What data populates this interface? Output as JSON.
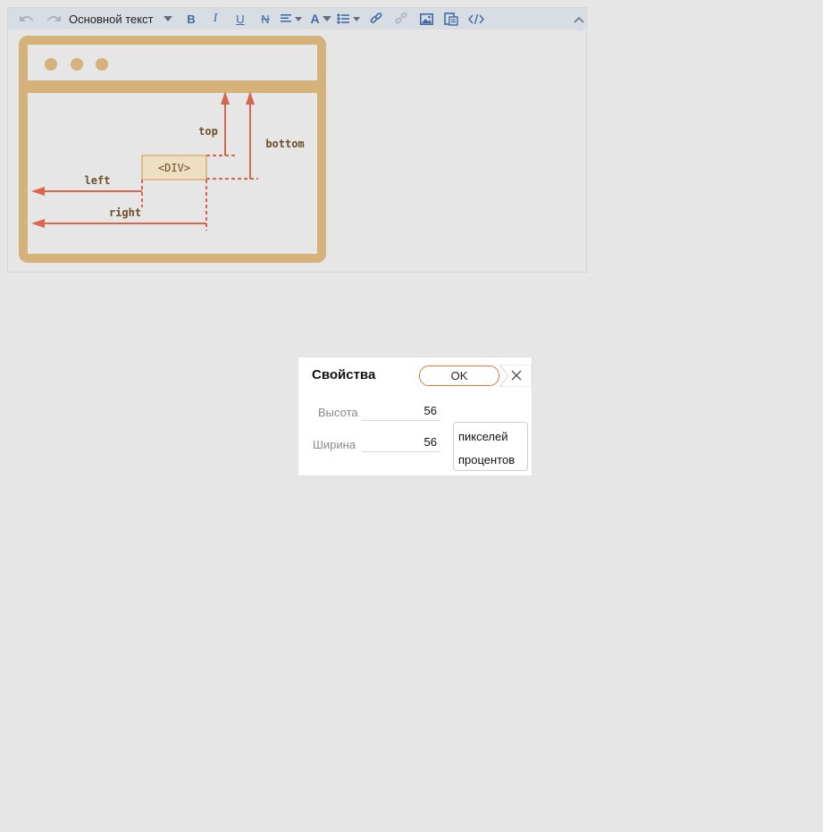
{
  "toolbar": {
    "format_label": "Основной текст",
    "icons": [
      "undo-icon",
      "redo-icon",
      "bold-icon",
      "italic-icon",
      "underline-icon",
      "strikethrough-icon",
      "align-icon",
      "font-color-icon",
      "list-icon",
      "link-icon",
      "unlink-icon",
      "image-icon",
      "paste-icon",
      "source-code-icon",
      "collapse-icon"
    ],
    "bold_glyph": "B",
    "italic_glyph": "I",
    "underline_glyph": "U",
    "strike_glyph": "N",
    "fontcolor_glyph": "A"
  },
  "figure": {
    "div_label": "<DIV>",
    "labels": {
      "top": "top",
      "bottom": "bottom",
      "left": "left",
      "right": "right"
    },
    "colors": {
      "frame": "#d4b27a",
      "arrow": "#d9654a",
      "text": "#6b4f2a"
    }
  },
  "dialog": {
    "title": "Свойства",
    "ok_label": "OK",
    "height_label": "Высота",
    "height_value": "56",
    "width_label": "Ширина",
    "width_value": "56",
    "unit_options": [
      "пикселей",
      "процентов"
    ],
    "accent_color": "#e07a3a"
  }
}
